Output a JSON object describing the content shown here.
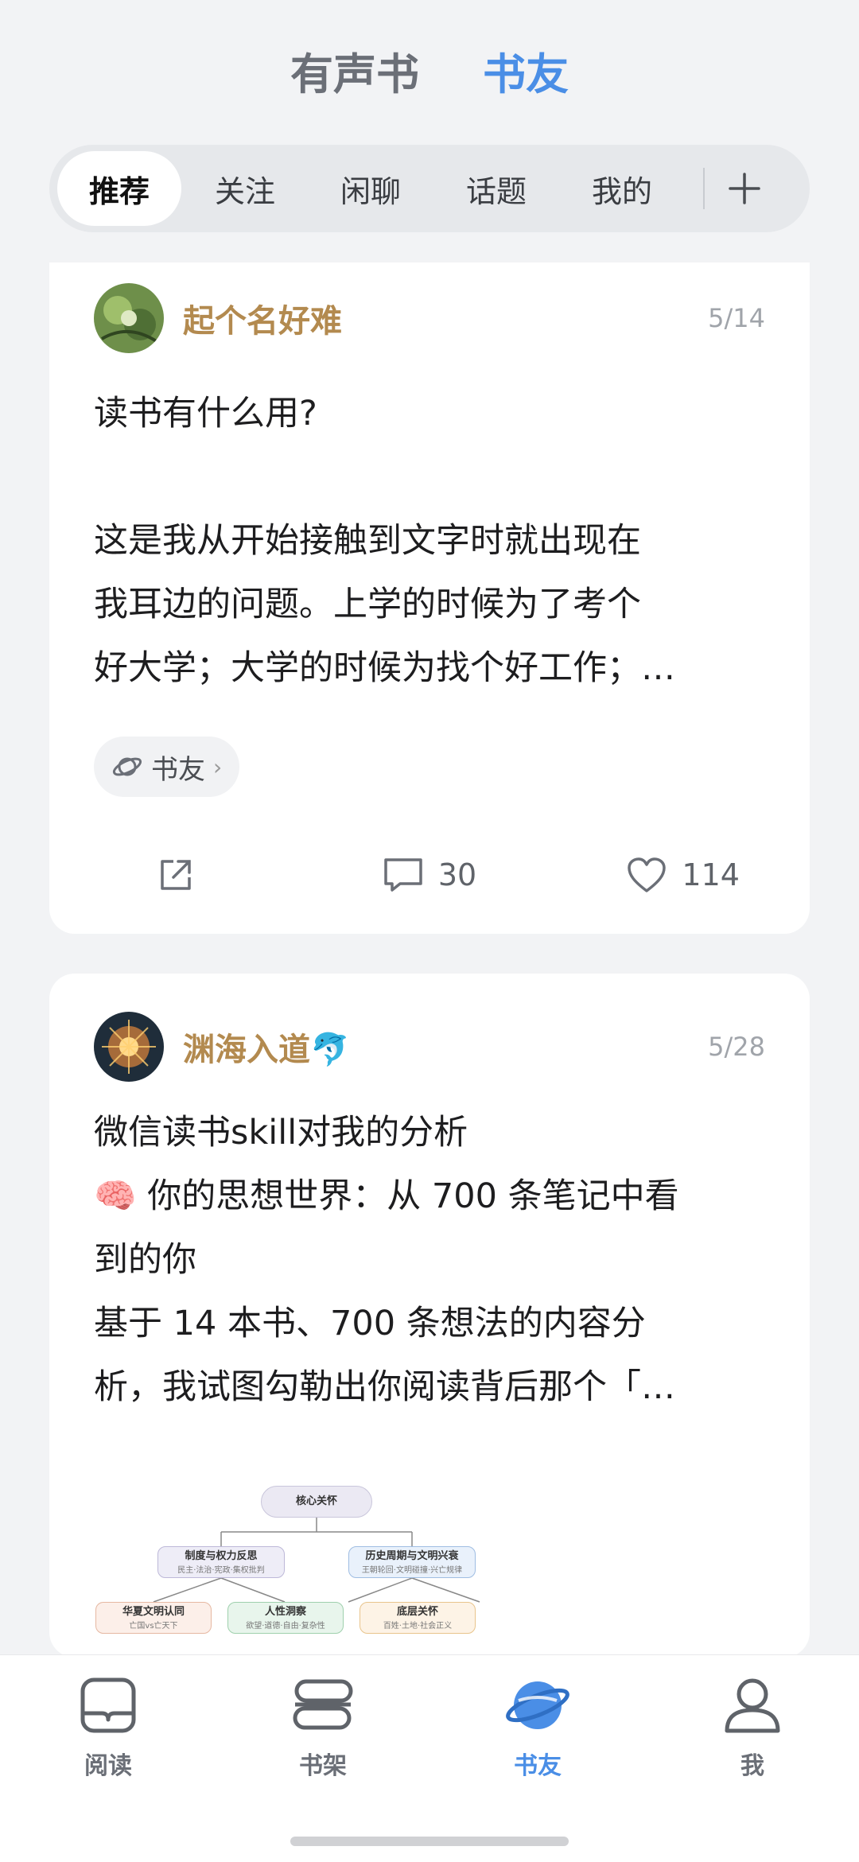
{
  "header": {
    "tabs": [
      "有声书",
      "书友"
    ],
    "active_tab": "书友"
  },
  "sub_tabs": {
    "items": [
      "推荐",
      "关注",
      "闲聊",
      "话题",
      "我的"
    ],
    "active": "推荐",
    "add_label": "+"
  },
  "posts": [
    {
      "author": "起个名好难",
      "date": "5/14",
      "lines": [
        "读书有什么用?",
        "",
        "这是我从开始接触到文字时就出现在",
        "我耳边的问题。上学的时候为了考个",
        "好大学；大学的时候为找个好工作；…"
      ],
      "tag": "书友",
      "comments": "30",
      "likes": "114"
    },
    {
      "author": "渊海入道🐬",
      "date": "5/28",
      "lines": [
        "微信读书skill对我的分析",
        "🧠 你的思想世界：从 700 条笔记中看",
        "到的你",
        "基于 14 本书、700 条想法的内容分",
        "析，我试图勾勒出你阅读背后那个「…"
      ],
      "mindmap": {
        "root": "核心关怀",
        "nodes": [
          {
            "title": "制度与权力反思",
            "sub": "民主·法治·宪政·集权批判"
          },
          {
            "title": "历史周期与文明兴衰",
            "sub": "王朝轮回·文明碰撞·兴亡规律"
          },
          {
            "title": "华夏文明认同",
            "sub": "亡国vs亡天下"
          },
          {
            "title": "人性洞察",
            "sub": "欲望·道德·自由·复杂性"
          },
          {
            "title": "底层关怀",
            "sub": "百姓·土地·社会正义"
          }
        ]
      }
    }
  ],
  "bottom_nav": {
    "items": [
      {
        "label": "阅读",
        "icon": "book-icon"
      },
      {
        "label": "书架",
        "icon": "bookshelf-icon"
      },
      {
        "label": "书友",
        "icon": "planet-icon"
      },
      {
        "label": "我",
        "icon": "person-icon"
      }
    ],
    "active": "书友"
  },
  "colors": {
    "accent": "#4a8ee6",
    "author": "#b38a4f",
    "background": "#f2f3f5"
  }
}
